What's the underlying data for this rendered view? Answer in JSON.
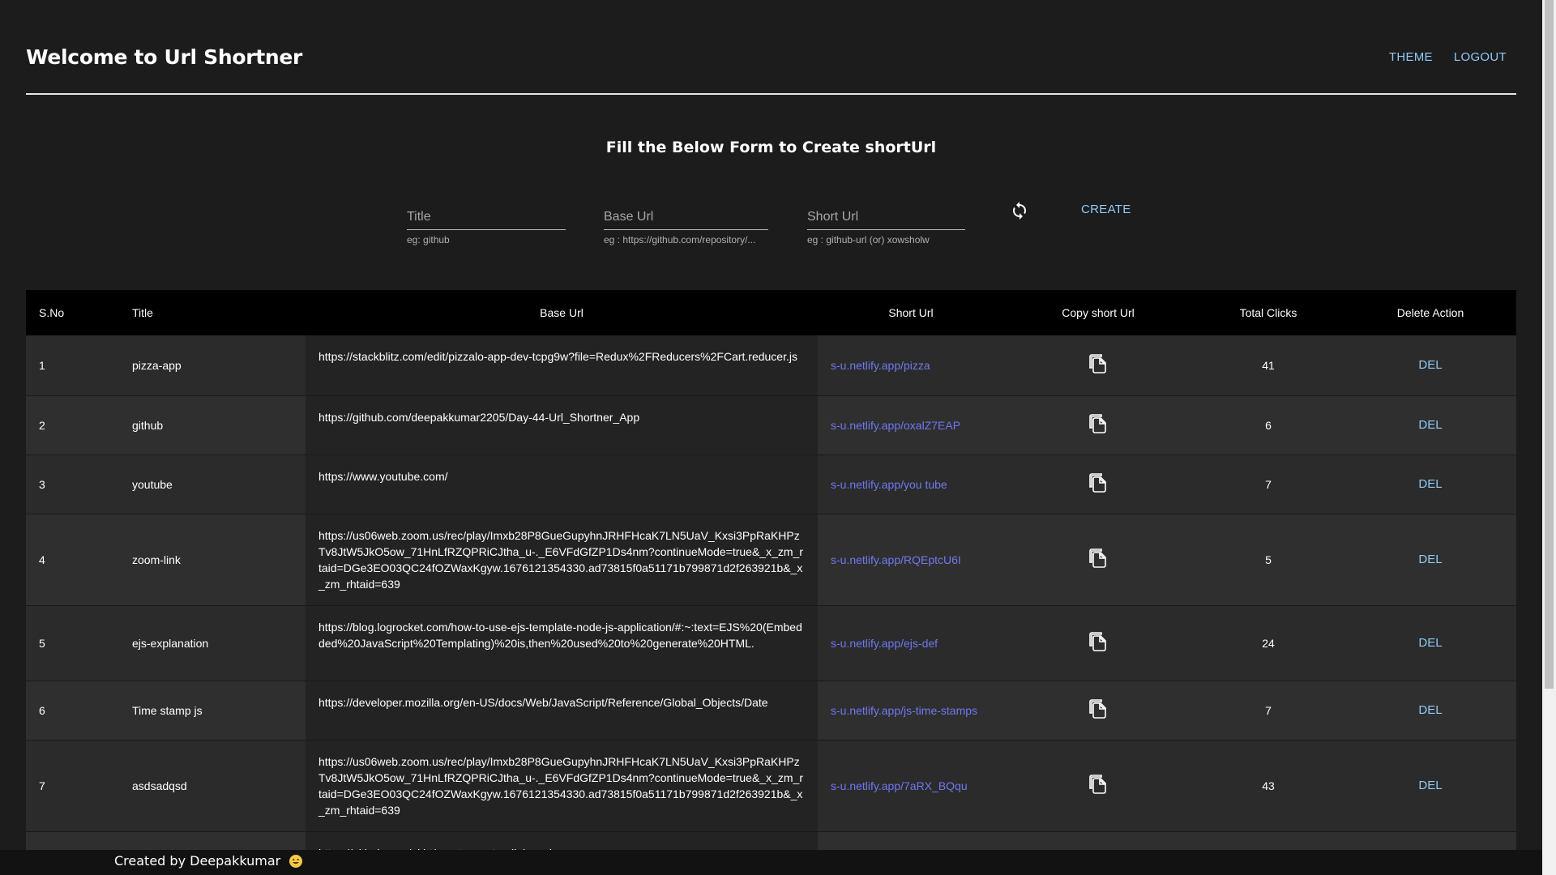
{
  "header": {
    "title": "Welcome to Url Shortner",
    "theme_label": "THEME",
    "logout_label": "LOGOUT"
  },
  "form": {
    "heading": "Fill the Below Form to Create shortUrl",
    "title_field": {
      "placeholder": "Title",
      "value": "",
      "helper": "eg: github"
    },
    "base_url_field": {
      "placeholder": "Base Url",
      "value": "",
      "helper": "eg : https://github.com/repository/..."
    },
    "short_url_field": {
      "placeholder": "Short Url",
      "value": "",
      "helper": "eg : github-url (or) xowsholw"
    },
    "refresh_icon": "refresh-icon",
    "create_label": "CREATE"
  },
  "table": {
    "columns": [
      "S.No",
      "Title",
      "Base Url",
      "Short Url",
      "Copy short Url",
      "Total Clicks",
      "Delete Action"
    ],
    "rows": [
      {
        "sno": "1",
        "title": "pizza-app",
        "base_url": "https://stackblitz.com/edit/pizzalo-app-dev-tcpg9w?file=Redux%2FReducers%2FCart.reducer.js",
        "short_url": "s-u.netlify.app/pizza",
        "clicks": "41",
        "del": "DEL"
      },
      {
        "sno": "2",
        "title": "github",
        "base_url": "https://github.com/deepakkumar2205/Day-44-Url_Shortner_App",
        "short_url": "s-u.netlify.app/oxalZ7EAP",
        "clicks": "6",
        "del": "DEL"
      },
      {
        "sno": "3",
        "title": "youtube",
        "base_url": "https://www.youtube.com/",
        "short_url": "s-u.netlify.app/you tube",
        "clicks": "7",
        "del": "DEL"
      },
      {
        "sno": "4",
        "title": "zoom-link",
        "base_url": "https://us06web.zoom.us/rec/play/Imxb28P8GueGupyhnJRHFHcaK7LN5UaV_Kxsi3PpRaKHPzTv8JtW5JkO5ow_71HnLfRZQPRiCJtha_u-._E6VFdGfZP1Ds4nm?continueMode=true&_x_zm_rtaid=DGe3EO03QC24fOZWaxKgyw.1676121354330.ad73815f0a51171b799871d2f263921b&_x_zm_rhtaid=639",
        "short_url": "s-u.netlify.app/RQEptcU6I",
        "clicks": "5",
        "del": "DEL"
      },
      {
        "sno": "5",
        "title": "ejs-explanation",
        "base_url": "https://blog.logrocket.com/how-to-use-ejs-template-node-js-application/#:~:text=EJS%20(Embedded%20JavaScript%20Templating)%20is,then%20used%20to%20generate%20HTML.",
        "short_url": "s-u.netlify.app/ejs-def",
        "clicks": "24",
        "del": "DEL"
      },
      {
        "sno": "6",
        "title": "Time stamp js",
        "base_url": "https://developer.mozilla.org/en-US/docs/Web/JavaScript/Reference/Global_Objects/Date",
        "short_url": "s-u.netlify.app/js-time-stamps",
        "clicks": "7",
        "del": "DEL"
      },
      {
        "sno": "7",
        "title": "asdsadqsd",
        "base_url": "https://us06web.zoom.us/rec/play/Imxb28P8GueGupyhnJRHFHcaK7LN5UaV_Kxsi3PpRaKHPzTv8JtW5JkO5ow_71HnLfRZQPRiCJtha_u-._E6VFdGfZP1Ds4nm?continueMode=true&_x_zm_rtaid=DGe3EO03QC24fOZWaxKgyw.1676121354330.ad73815f0a51171b799871d2f263921b&_x_zm_rhtaid=639",
        "short_url": "s-u.netlify.app/7aRX_BQqu",
        "clicks": "43",
        "del": "DEL"
      },
      {
        "sno": "",
        "title": "",
        "base_url": "https://github.com/nkbt/react-copy-to-clipboard",
        "short_url": "",
        "clicks": "",
        "del": ""
      }
    ]
  },
  "footer": {
    "text": "Created by Deepakkumar",
    "emoji_icon": "grinning-face-icon"
  },
  "colors": {
    "background": "#1c1c1c",
    "accent": "#90caf9",
    "link": "#6f78f0",
    "table_header": "#000000"
  }
}
